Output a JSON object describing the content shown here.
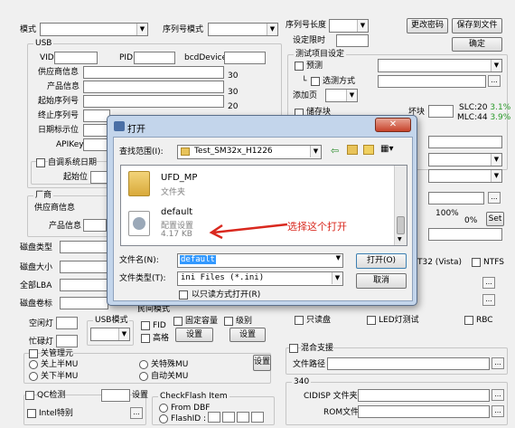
{
  "main": {
    "mode_label": "模式",
    "serial_mode_label": "序列号模式",
    "serial_len_label": "序列号长度",
    "limit_label": "设定限时",
    "change_pwd": "更改密码",
    "save_file": "保存到文件",
    "confirm": "确定",
    "usb_group": "USB",
    "vid_label": "VID",
    "pid_label": "PID",
    "bcd_label": "bcdDevice",
    "vendor_label": "供应商信息",
    "product_label": "产品信息",
    "start_serial_label": "起始序列号",
    "end_serial_label": "终止序列号",
    "date_label": "日期标示位",
    "apikey_label": "APIKey",
    "n30a": "30",
    "n30b": "30",
    "n20a": "20",
    "n20b": "20",
    "auto_date": "自调系统日期",
    "start_pos": "起始位",
    "test_group": "测试项目设定",
    "pre_test": "预测",
    "pick_method": "选测方式",
    "add_page": "添加页",
    "store_block": "储存块",
    "bad_block": "坏块",
    "slc": "SLC:20",
    "slc_pct": "3.1%",
    "mlc": "MLC:44",
    "mlc_pct": "3.9%",
    "pct100": "100%",
    "pct0": "0%",
    "set_btn": "Set",
    "fat32": "T32 (Vista)",
    "ntfs": "NTFS",
    "vendor_group": "厂商",
    "vendor2": "供应商信息",
    "product2": "产品信息",
    "disk_type": "磁盘类型",
    "disk_size": "磁盘大小",
    "all_lba": "全部LBA",
    "disk_label": "磁盘卷标",
    "idle_light": "空闲灯",
    "busy_light": "忙碌灯",
    "usb_mode": "USB模式",
    "fid": "FID",
    "high": "高格",
    "fixed_cap": "固定容量",
    "level": "级别",
    "setting": "设置",
    "setting2": "设置",
    "fixed_cap_partial": "民间模式",
    "readonly_disk": "只读盘",
    "led_test": "LED灯测试",
    "rbc": "RBC",
    "switch_group": "关管理元",
    "off_half_mu": "关上半MU",
    "off_low_mu": "关下半MU",
    "off_special_mu": "关特殊MU",
    "auto_off_mu": "自动关MU",
    "setting3": "设置",
    "mix_support": "混合支援",
    "file_path": "文件路径",
    "g340": "340",
    "cid": "CID",
    "isp_file": "ISP 文件夹",
    "rom_file": "ROM文件",
    "qc_detect": "QC检测",
    "qc_set": "设置",
    "intel": "Intel特别",
    "checkflash": "CheckFlash Item",
    "from_dbf": "From DBF",
    "flash_id": "FlashID :"
  },
  "dialog": {
    "title": "打开",
    "close": "✕",
    "lookin_label": "查找范围(I):",
    "lookin_value": "Test_SM32x_H1226",
    "folder_name": "UFD_MP",
    "folder_type": "文件夹",
    "file_name": "default",
    "file_type": "配置设置",
    "file_size": "4.17 KB",
    "annotation": "选择这个打开",
    "filename_label": "文件名(N):",
    "filename_value": "default",
    "filetype_label": "文件类型(T):",
    "filetype_value": "ini Files (*.ini)",
    "readonly_label": "以只读方式打开(R)",
    "open_btn": "打开(O)",
    "cancel_btn": "取消"
  },
  "colors": {
    "annotation": "#d9281e",
    "green": "#2a9a2a",
    "select": "#3399ff"
  }
}
